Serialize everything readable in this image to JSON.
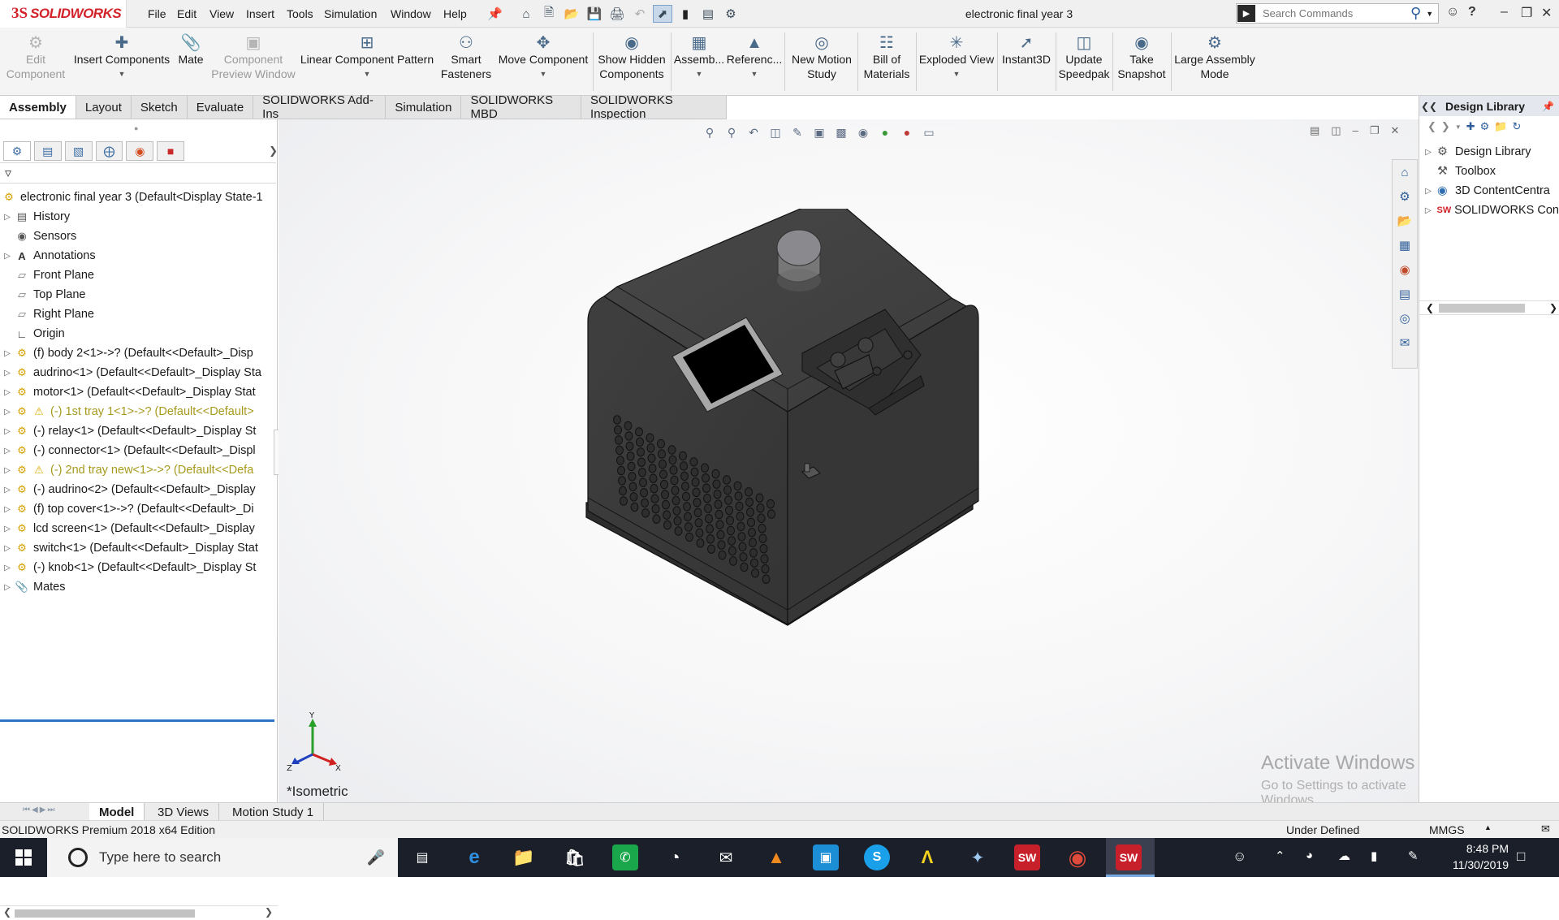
{
  "app": {
    "logo_prefix": "3S",
    "logo_text": "SOLIDWORKS",
    "document_title": "electronic final year 3"
  },
  "menu": [
    "File",
    "Edit",
    "View",
    "Insert",
    "Tools",
    "Simulation",
    "Window",
    "Help"
  ],
  "search": {
    "placeholder": "Search Commands"
  },
  "command_manager": {
    "edit_component": [
      "Edit",
      "Component"
    ],
    "insert_components": "Insert Components",
    "mate": "Mate",
    "component_preview": [
      "Component",
      "Preview Window"
    ],
    "linear_pattern": "Linear Component Pattern",
    "smart_fasteners": [
      "Smart",
      "Fasteners"
    ],
    "move_component": "Move Component",
    "show_hidden": [
      "Show Hidden",
      "Components"
    ],
    "assembly": "Assemb...",
    "reference": "Referenc...",
    "new_motion_study": [
      "New Motion",
      "Study"
    ],
    "bill_of_materials": [
      "Bill of",
      "Materials"
    ],
    "exploded_view": "Exploded View",
    "instant3d": "Instant3D",
    "update_speedpak": [
      "Update",
      "Speedpak"
    ],
    "take_snapshot": [
      "Take",
      "Snapshot"
    ],
    "large_assembly": [
      "Large Assembly",
      "Mode"
    ]
  },
  "tabs": [
    "Assembly",
    "Layout",
    "Sketch",
    "Evaluate",
    "SOLIDWORKS Add-Ins",
    "Simulation",
    "SOLIDWORKS MBD",
    "SOLIDWORKS Inspection"
  ],
  "tree": {
    "root": "electronic final year 3  (Default<Display State-1",
    "items": [
      {
        "label": "History"
      },
      {
        "label": "Sensors"
      },
      {
        "label": "Annotations"
      },
      {
        "label": "Front Plane"
      },
      {
        "label": "Top Plane"
      },
      {
        "label": "Right Plane"
      },
      {
        "label": "Origin"
      },
      {
        "label": "(f) body 2<1>->? (Default<<Default>_Disp"
      },
      {
        "label": "audrino<1> (Default<<Default>_Display Sta"
      },
      {
        "label": "motor<1> (Default<<Default>_Display Stat"
      },
      {
        "label": "(-) 1st tray 1<1>->? (Default<<Default>"
      },
      {
        "label": "(-) relay<1> (Default<<Default>_Display St"
      },
      {
        "label": "(-) connector<1> (Default<<Default>_Displ"
      },
      {
        "label": "(-) 2nd tray new<1>->? (Default<<Defa"
      },
      {
        "label": "(-) audrino<2> (Default<<Default>_Display"
      },
      {
        "label": "(f) top cover<1>->? (Default<<Default>_Di"
      },
      {
        "label": "lcd screen<1> (Default<<Default>_Display"
      },
      {
        "label": "switch<1> (Default<<Default>_Display Stat"
      },
      {
        "label": "(-) knob<1> (Default<<Default>_Display St"
      },
      {
        "label": "Mates"
      }
    ]
  },
  "viewport": {
    "view_name": "*Isometric",
    "triad": {
      "y": "Y",
      "z": "Z",
      "x": "X"
    },
    "watermark_title": "Activate Windows",
    "watermark_sub": "Go to Settings to activate Windows."
  },
  "design_library": {
    "title": "Design Library",
    "items": [
      "Design Library",
      "Toolbox",
      "3D ContentCentra",
      "SOLIDWORKS Con"
    ]
  },
  "bottom_tabs": [
    "Model",
    "3D Views",
    "Motion Study 1"
  ],
  "status": {
    "edition": "SOLIDWORKS Premium 2018 x64 Edition",
    "state": "Under Defined",
    "units": "MMGS"
  },
  "taskbar": {
    "search_placeholder": "Type here to search",
    "time": "8:48 PM",
    "date": "11/30/2019"
  },
  "colors": {
    "accent": "#d2232a",
    "model_body": "#3c3c3c",
    "selection_line": "#2e74c8",
    "warning_text": "#a69a1e"
  }
}
